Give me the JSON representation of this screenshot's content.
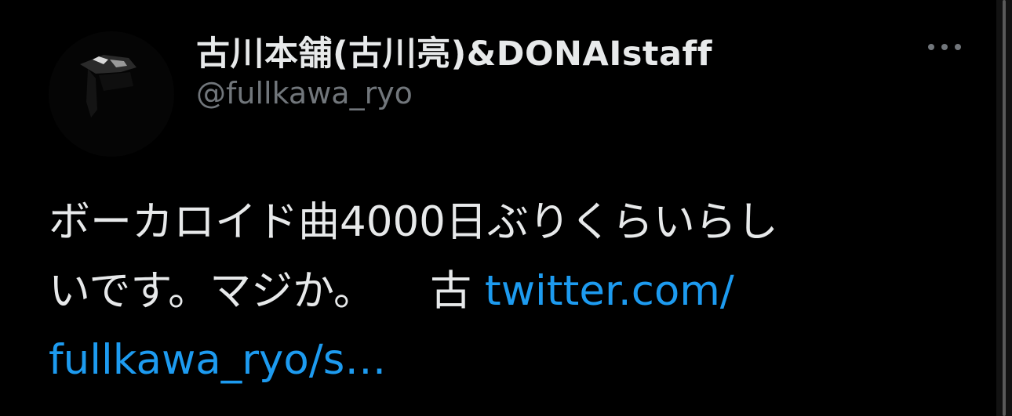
{
  "tweet": {
    "author": {
      "display_name": "古川本舗(古川亮)&DONAIstaff",
      "handle": "@fullkawa_ryo",
      "avatar_icon": "profile-avatar"
    },
    "more_icon": "more-horizontal-icon",
    "text": {
      "line1": "ボーカロイド曲4000日ぶりくらいらし",
      "line2": "いです。マジか。",
      "line2_tail": "古",
      "link_part1": "twitter.com/",
      "link_part2": "fullkawa_ryo/s…"
    }
  },
  "colors": {
    "background": "#000000",
    "text": "#e7e9ea",
    "secondary": "#71767b",
    "link": "#1d9bf0"
  }
}
